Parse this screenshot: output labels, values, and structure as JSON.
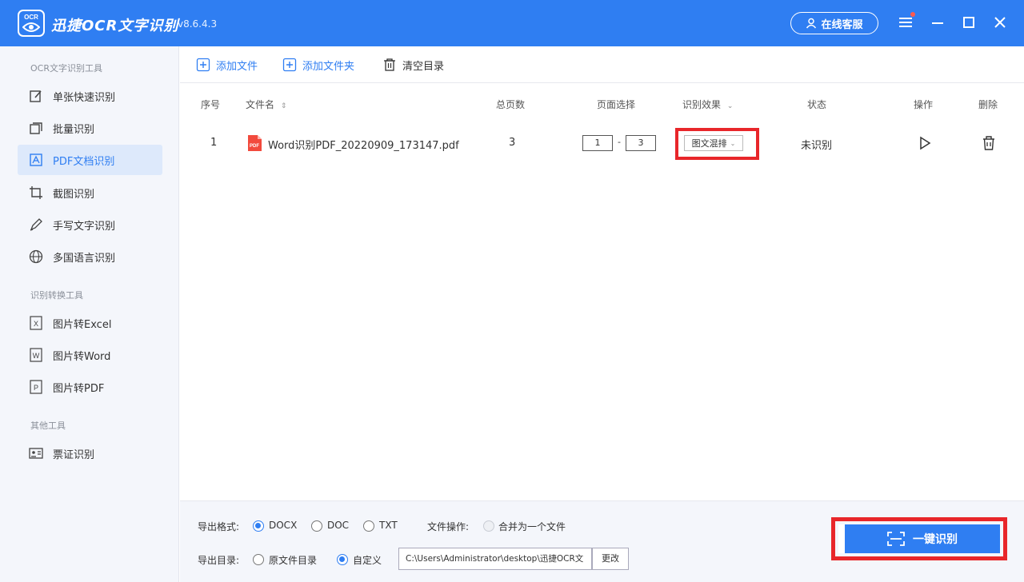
{
  "titlebar": {
    "logo_text": "OCR",
    "title": "迅捷OCR文字识别",
    "version": "v8.6.4.3",
    "support_label": "在线客服"
  },
  "sidebar": {
    "sections": [
      {
        "label": "OCR文字识别工具"
      },
      {
        "label": "识别转换工具"
      },
      {
        "label": "其他工具"
      }
    ],
    "items": [
      {
        "label": "单张快速识别",
        "icon": "edit-icon",
        "active": false
      },
      {
        "label": "批量识别",
        "icon": "stack-icon",
        "active": false
      },
      {
        "label": "PDF文档识别",
        "icon": "pdf-icon",
        "active": true
      },
      {
        "label": "截图识别",
        "icon": "crop-icon",
        "active": false
      },
      {
        "label": "手写文字识别",
        "icon": "pen-icon",
        "active": false
      },
      {
        "label": "多国语言识别",
        "icon": "globe-icon",
        "active": false
      },
      {
        "label": "图片转Excel",
        "icon": "excel-icon",
        "active": false
      },
      {
        "label": "图片转Word",
        "icon": "word-icon",
        "active": false
      },
      {
        "label": "图片转PDF",
        "icon": "pdf-doc-icon",
        "active": false
      },
      {
        "label": "票证识别",
        "icon": "card-icon",
        "active": false
      }
    ]
  },
  "toolbar": {
    "add_file": "添加文件",
    "add_folder": "添加文件夹",
    "clear_list": "清空目录"
  },
  "table": {
    "headers": {
      "index": "序号",
      "filename": "文件名",
      "total_pages": "总页数",
      "page_select": "页面选择",
      "effect": "识别效果",
      "status": "状态",
      "action": "操作",
      "delete": "删除"
    },
    "rows": [
      {
        "index": "1",
        "filename": "Word识别PDF_20220909_173147.pdf",
        "total_pages": "3",
        "page_from": "1",
        "page_sep": "-",
        "page_to": "3",
        "effect": "图文混排",
        "status": "未识别"
      }
    ]
  },
  "bottom": {
    "format_label": "导出格式:",
    "formats": [
      {
        "label": "DOCX",
        "checked": true
      },
      {
        "label": "DOC",
        "checked": false
      },
      {
        "label": "TXT",
        "checked": false
      }
    ],
    "file_op_label": "文件操作:",
    "merge_label": "合并为一个文件",
    "dir_label": "导出目录:",
    "dir_options": [
      {
        "label": "原文件目录",
        "checked": false
      },
      {
        "label": "自定义",
        "checked": true
      }
    ],
    "path": "C:\\Users\\Administrator\\desktop\\迅捷OCR文",
    "change_label": "更改",
    "go_label": "一键识别"
  },
  "colors": {
    "brand": "#2f7ef2",
    "highlight": "#e8262a"
  }
}
